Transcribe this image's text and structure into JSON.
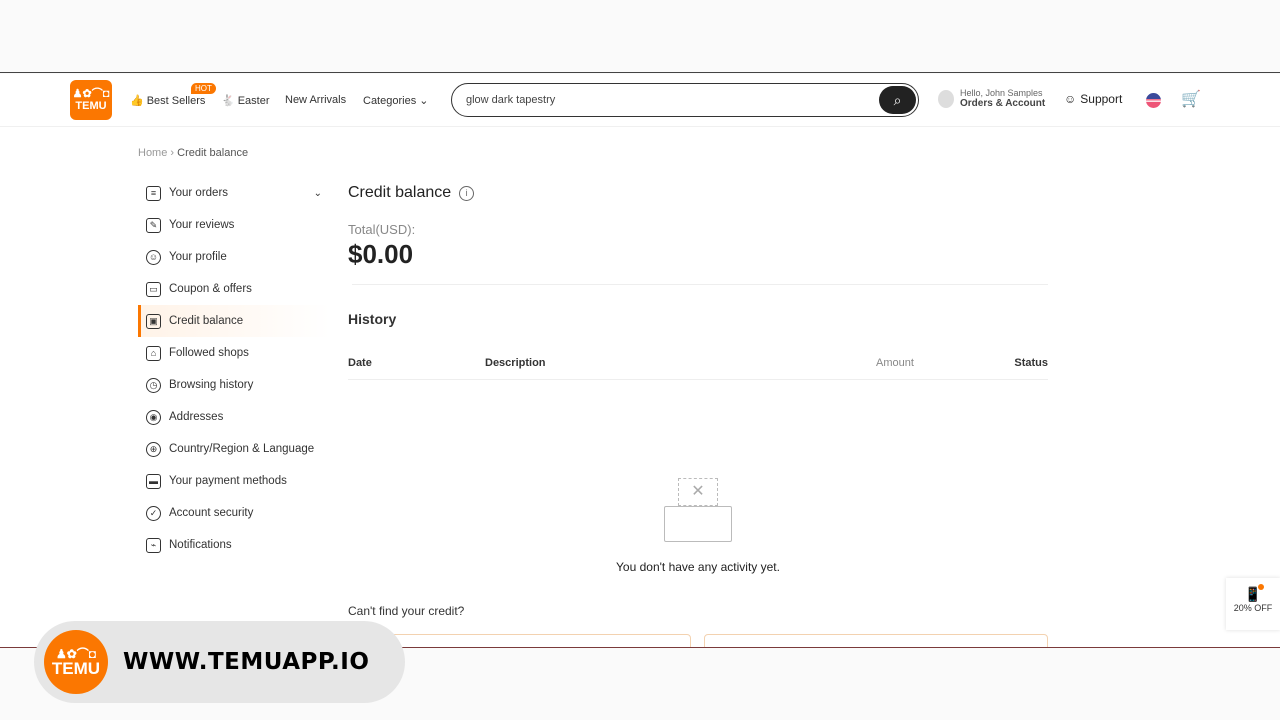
{
  "header": {
    "logo": "TEMU",
    "logo_glyphs": "♟✿⌒◘",
    "nav": [
      {
        "label": "Best Sellers",
        "icon": "thumbs-up-icon",
        "badge": "HOT"
      },
      {
        "label": "Easter",
        "icon": "rabbit-icon"
      },
      {
        "label": "New Arrivals"
      },
      {
        "label": "Categories",
        "icon": "chevron-down-icon"
      }
    ],
    "search_value": "glow dark tapestry",
    "greeting": "Hello, John Samples",
    "account": "Orders & Account",
    "support": "Support"
  },
  "breadcrumb": {
    "home": "Home",
    "sep": "›",
    "current": "Credit balance"
  },
  "sidebar": {
    "items": [
      {
        "label": "Your orders",
        "icon": "orders-icon"
      },
      {
        "label": "Your reviews",
        "icon": "reviews-icon"
      },
      {
        "label": "Your profile",
        "icon": "profile-icon"
      },
      {
        "label": "Coupon & offers",
        "icon": "coupon-icon"
      },
      {
        "label": "Credit balance",
        "icon": "wallet-icon",
        "active": true
      },
      {
        "label": "Followed shops",
        "icon": "shop-icon"
      },
      {
        "label": "Browsing history",
        "icon": "clock-icon"
      },
      {
        "label": "Addresses",
        "icon": "location-icon"
      },
      {
        "label": "Country/Region & Language",
        "icon": "globe-icon"
      },
      {
        "label": "Your payment methods",
        "icon": "card-icon"
      },
      {
        "label": "Account security",
        "icon": "shield-icon"
      },
      {
        "label": "Notifications",
        "icon": "bell-icon"
      }
    ]
  },
  "main": {
    "title": "Credit balance",
    "total_label": "Total(USD):",
    "total": "$0.00",
    "history": "History",
    "columns": [
      "Date",
      "Description",
      "Amount",
      "Status"
    ],
    "empty": "You don't have any activity yet.",
    "cant_find": "Can't find your credit?"
  },
  "promo": {
    "label": "20% OFF"
  },
  "watermark": {
    "text": "WWW.TEMUAPP.IO",
    "logo": "TEMU"
  },
  "colors": {
    "accent": "#fb7701"
  }
}
